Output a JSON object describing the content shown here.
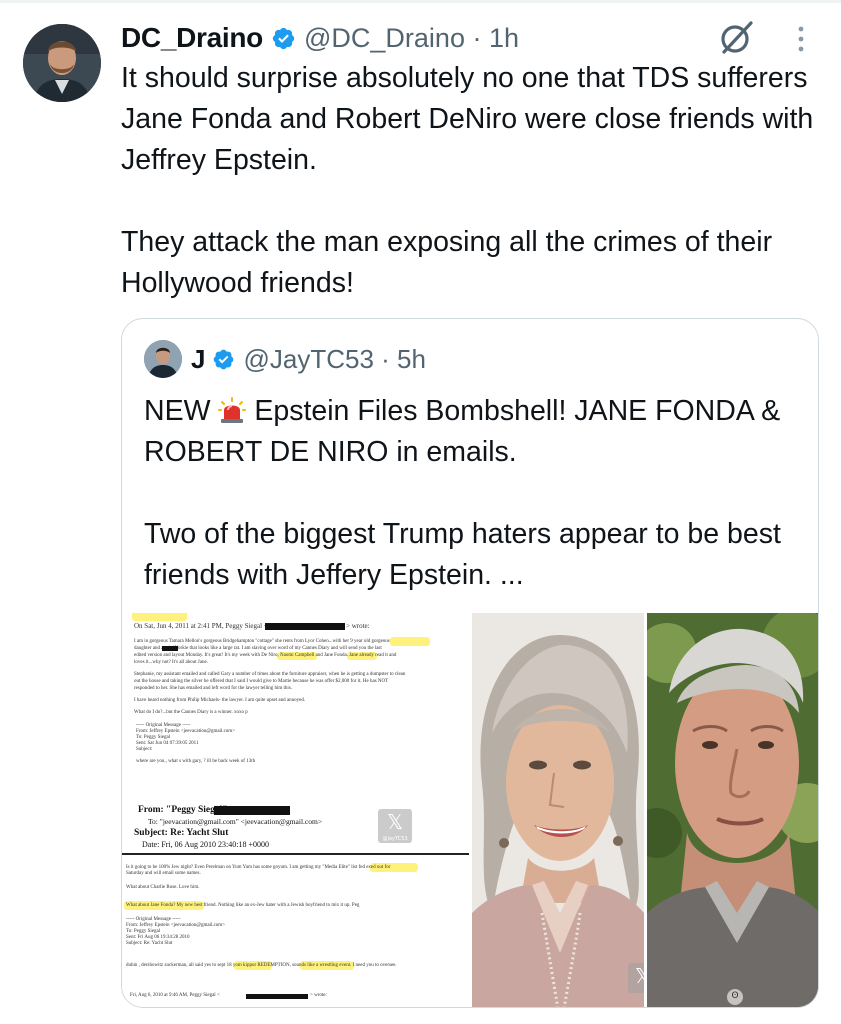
{
  "tweet": {
    "author_name": "DC_Draino",
    "handle_time": "@DC_Draino · 1h",
    "text": "It should surprise absolutely no one that TDS sufferers Jane Fonda and Robert DeNiro were close friends with Jeffrey Epstein.\n\nThey attack the man exposing all the crimes of their Hollywood friends!",
    "verified_icon": "verified-badge-icon",
    "grok_icon": "grok-icon",
    "more_icon": "more-options-icon"
  },
  "quote": {
    "author_name": "J",
    "handle_time": "@JayTC53 · 5h",
    "text_before_emoji": "NEW ",
    "text_after_emoji": " Epstein Files Bombshell! JANE FONDA & ROBERT DE NIRO in emails.\n\nTwo of the biggest Trump haters appear to be best friends with Jeffery Epstein. ...",
    "emoji_icon": "police-siren-icon"
  },
  "document": {
    "line1": "On Sat, Jun 4, 2011 at 2:41 PM, Peggy Siegal <",
    "line1_end": "> wrote:",
    "p1": "I am in gorgeous Tamara Mellon's gorgeous Bridgehampton \"cottage\" she rents from Lyor Cohen...with her 9 year old gorgeous",
    "p1b": "daughter        and a mini Yorkie that looks like a large rat.  I am slaving over word of my Cannes Diary and will send you the last",
    "p1c": "edited version and layout Monday.  It's great!  It's my week with De Niro, Naomi Campbell and Jane Fonda. Jane already read it and",
    "p1d": "loves it...why not?  It's all about Jane.",
    "p2": "Stephanie, my assistant emailed and called Gary a number of times about the furniture appraiser, when he is getting a dumpster to clean",
    "p2b": "out the house and taking the silver he offered that I said I would give to Martie because he was offer $2,000 for it.  He has NOT",
    "p2c": "responded to her. She has emailed and left word for the lawyer telling him this.",
    "p3": "I have heard nothing from Philip Michaels- the lawyer.  I am quite upset and annoyed.",
    "p4": "What do I do?...but the Cannes Diary is a winner.  xoxo p",
    "orig1": "----- Original Message -----",
    "orig2": "From: Jeffrey Epstein <jeevacation@gmail.com>",
    "orig3": "To: Peggy Siegal",
    "orig4": "Sent: Sat Jun 04 07:39:05 2011",
    "orig5": "Subject:",
    "p5": "where are  you., what s with gary, ? ill be back week of 13th",
    "from": "From:  \"Peggy Siegal\" <",
    "to": "To:  \"jeevacation@gmail.com\" <jeevacation@gmail.com>",
    "subject": "Subject:  Re: Yacht Slut",
    "date": "Date:  Fri, 06 Aug 2010 23:40:18 +0000",
    "q1": "Is it going to be 100% Jew night?  Even Perelman on Yum Yum has some goyum.  I am getting my \"Media Elite\" list fed exed out for",
    "q1b": "Saturday and will email some names.",
    "q2": "What about Charlie Rose. Love him.",
    "q3": "What about Jane Fonda? My new best friend.  Nothing like an ex-Jew hater with a Jewish boyfriend to mix it up.  Peg",
    "o1": "----- Original Message -----",
    "o2": "From: Jeffrey Epstein <jeevacation@gmail.com>",
    "o3": "To: Peggy Siegal",
    "o4": "Sent: Fri Aug 06 19:34:28 2010",
    "o5": "Subject: Re: Yacht Slut",
    "q4": "dubin , dershowitz zuckerman, all said yes to sept 18  yom kippur  REDEMPTION, sounds like a wrestling event. I need you to oversee.",
    "last": "Fri, Aug 6, 2010 at 9:46 AM, Peggy Siegal <",
    "last_end": "> wrote:",
    "watermark": "@JayTC53"
  },
  "colors": {
    "text": "#0f1419",
    "secondary": "#536471",
    "verified": "#1d9bf0",
    "border": "#cfd9de"
  }
}
